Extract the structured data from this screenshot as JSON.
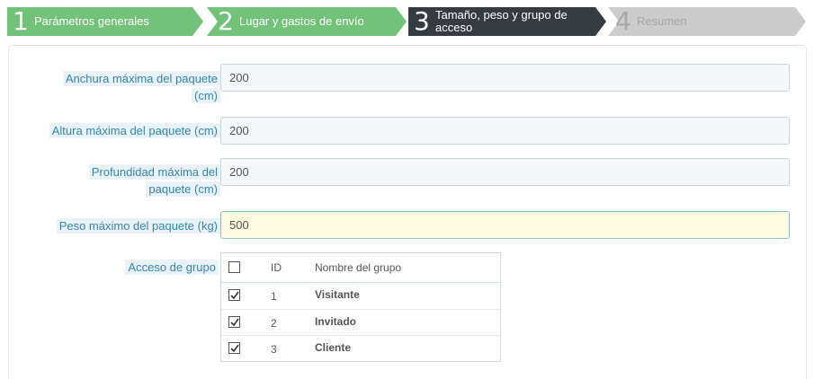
{
  "steps": [
    {
      "number": "1",
      "label": "Parámetros generales",
      "state": "done"
    },
    {
      "number": "2",
      "label": "Lugar y gastos de envío",
      "state": "done"
    },
    {
      "number": "3",
      "label": "Tamaño, peso y grupo de acceso",
      "state": "active"
    },
    {
      "number": "4",
      "label": "Resumen",
      "state": "pending"
    }
  ],
  "colors": {
    "step_done": "#72c279",
    "step_active": "#363a41",
    "step_pending": "#cccccc",
    "label_text": "#3586ae",
    "label_bg": "#e9f2f7"
  },
  "form": {
    "max_width": {
      "label": "Anchura máxima del paquete (cm)",
      "value": "200"
    },
    "max_height": {
      "label": "Altura máxima del paquete (cm)",
      "value": "200"
    },
    "max_depth": {
      "label": "Profundidad máxima del paquete (cm)",
      "value": "200"
    },
    "max_weight": {
      "label": "Peso máximo del paquete (kg)",
      "value": "500"
    },
    "group_access": {
      "label": "Acceso de grupo",
      "columns": {
        "id": "ID",
        "name": "Nombre del grupo"
      },
      "select_all_checked": false,
      "groups": [
        {
          "id": "1",
          "name": "Visitante",
          "checked": true
        },
        {
          "id": "2",
          "name": "Invitado",
          "checked": true
        },
        {
          "id": "3",
          "name": "Cliente",
          "checked": true
        }
      ]
    }
  }
}
